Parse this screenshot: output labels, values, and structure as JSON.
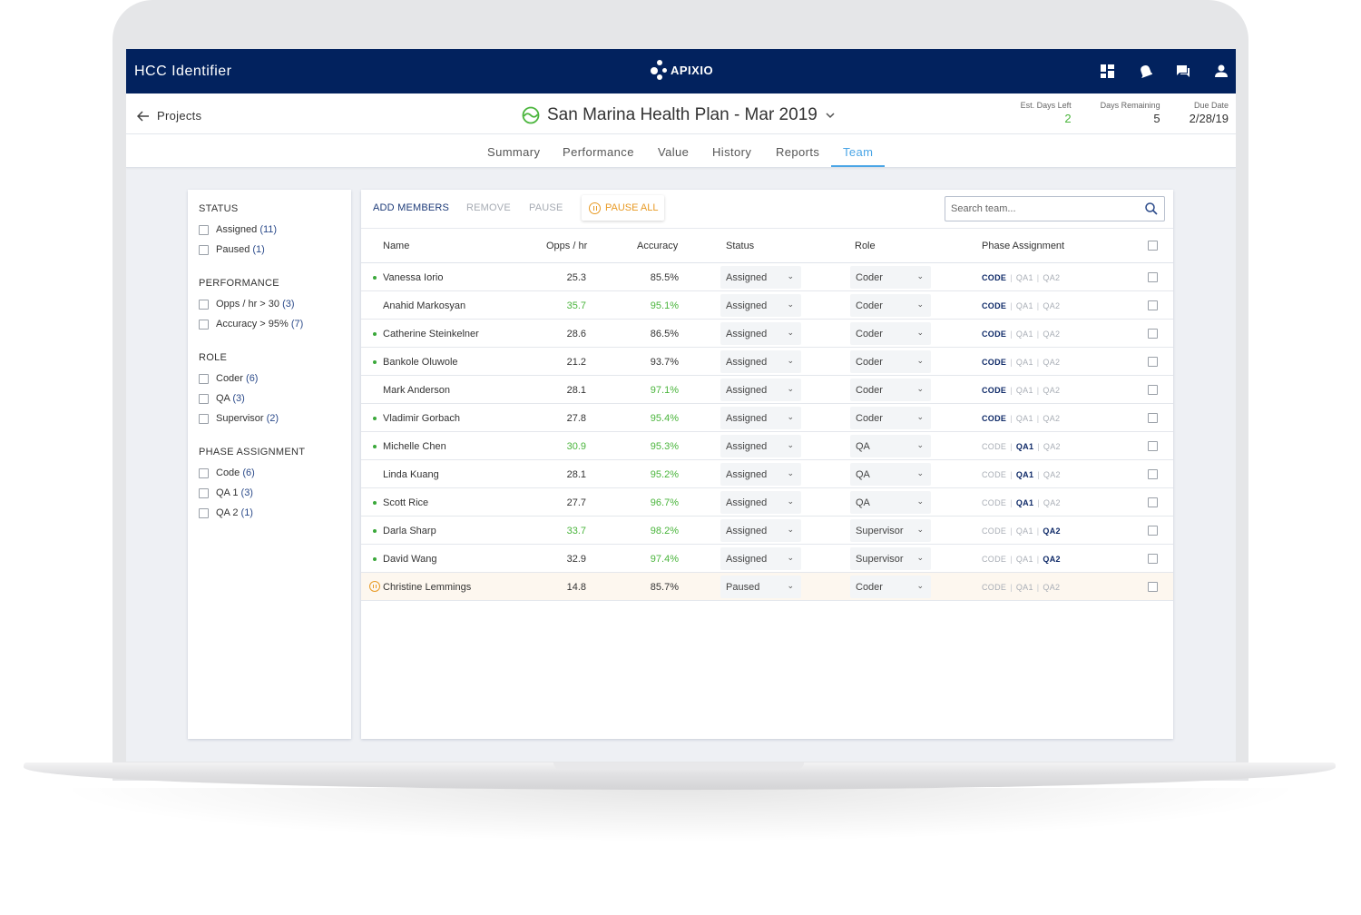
{
  "app": {
    "title": "HCC Identifier",
    "logo_text": "APIXIO"
  },
  "topbar_icons": [
    "dashboard-icon",
    "notifications-icon",
    "messages-icon",
    "user-icon"
  ],
  "header": {
    "back_label": "Projects",
    "project_title": "San Marina Health Plan - Mar 2019",
    "project_status_color": "#4ab53c",
    "stats": [
      {
        "label": "Est. Days Left",
        "value": "2",
        "color": "#4ab53c"
      },
      {
        "label": "Days Remaining",
        "value": "5"
      },
      {
        "label": "Due Date",
        "value": "2/28/19"
      }
    ]
  },
  "tabs": [
    {
      "label": "Summary"
    },
    {
      "label": "Performance"
    },
    {
      "label": "Value"
    },
    {
      "label": "History"
    },
    {
      "label": "Reports"
    },
    {
      "label": "Team",
      "active": true
    }
  ],
  "filters": {
    "groups": [
      {
        "title": "STATUS",
        "items": [
          {
            "label": "Assigned",
            "count": "(11)"
          },
          {
            "label": "Paused",
            "count": "(1)"
          }
        ]
      },
      {
        "title": "PERFORMANCE",
        "items": [
          {
            "label": "Opps / hr > 30",
            "count": "(3)"
          },
          {
            "label": "Accuracy > 95%",
            "count": "(7)"
          }
        ]
      },
      {
        "title": "ROLE",
        "items": [
          {
            "label": "Coder",
            "count": "(6)"
          },
          {
            "label": "QA",
            "count": "(3)"
          },
          {
            "label": "Supervisor",
            "count": "(2)"
          }
        ]
      },
      {
        "title": "PHASE ASSIGNMENT",
        "items": [
          {
            "label": "Code",
            "count": "(6)"
          },
          {
            "label": "QA 1",
            "count": "(3)"
          },
          {
            "label": "QA 2",
            "count": "(1)"
          }
        ]
      }
    ]
  },
  "toolbar": {
    "add_members": "ADD MEMBERS",
    "remove": "REMOVE",
    "pause": "PAUSE",
    "pause_all": "PAUSE ALL",
    "search_placeholder": "Search team..."
  },
  "table": {
    "columns": {
      "name": "Name",
      "opps": "Opps / hr",
      "accuracy": "Accuracy",
      "status": "Status",
      "role": "Role",
      "phase": "Phase Assignment"
    },
    "phase_labels": [
      "CODE",
      "QA1",
      "QA2"
    ],
    "rows": [
      {
        "indicator": "online",
        "name": "Vanessa Iorio",
        "opps": "25.3",
        "opps_high": false,
        "accuracy": "85.5%",
        "acc_high": false,
        "status": "Assigned",
        "role": "Coder",
        "phase": "CODE"
      },
      {
        "indicator": "none",
        "name": "Anahid Markosyan",
        "opps": "35.7",
        "opps_high": true,
        "accuracy": "95.1%",
        "acc_high": true,
        "status": "Assigned",
        "role": "Coder",
        "phase": "CODE"
      },
      {
        "indicator": "online",
        "name": "Catherine Steinkelner",
        "opps": "28.6",
        "opps_high": false,
        "accuracy": "86.5%",
        "acc_high": false,
        "status": "Assigned",
        "role": "Coder",
        "phase": "CODE"
      },
      {
        "indicator": "online",
        "name": "Bankole Oluwole",
        "opps": "21.2",
        "opps_high": false,
        "accuracy": "93.7%",
        "acc_high": false,
        "status": "Assigned",
        "role": "Coder",
        "phase": "CODE"
      },
      {
        "indicator": "none",
        "name": "Mark Anderson",
        "opps": "28.1",
        "opps_high": false,
        "accuracy": "97.1%",
        "acc_high": true,
        "status": "Assigned",
        "role": "Coder",
        "phase": "CODE"
      },
      {
        "indicator": "online",
        "name": "Vladimir Gorbach",
        "opps": "27.8",
        "opps_high": false,
        "accuracy": "95.4%",
        "acc_high": true,
        "status": "Assigned",
        "role": "Coder",
        "phase": "CODE"
      },
      {
        "indicator": "online",
        "name": "Michelle Chen",
        "opps": "30.9",
        "opps_high": true,
        "accuracy": "95.3%",
        "acc_high": true,
        "status": "Assigned",
        "role": "QA",
        "phase": "QA1"
      },
      {
        "indicator": "none",
        "name": "Linda Kuang",
        "opps": "28.1",
        "opps_high": false,
        "accuracy": "95.2%",
        "acc_high": true,
        "status": "Assigned",
        "role": "QA",
        "phase": "QA1"
      },
      {
        "indicator": "online",
        "name": "Scott Rice",
        "opps": "27.7",
        "opps_high": false,
        "accuracy": "96.7%",
        "acc_high": true,
        "status": "Assigned",
        "role": "QA",
        "phase": "QA1"
      },
      {
        "indicator": "online",
        "name": "Darla Sharp",
        "opps": "33.7",
        "opps_high": true,
        "accuracy": "98.2%",
        "acc_high": true,
        "status": "Assigned",
        "role": "Supervisor",
        "phase": "QA2"
      },
      {
        "indicator": "online",
        "name": "David Wang",
        "opps": "32.9",
        "opps_high": false,
        "accuracy": "97.4%",
        "acc_high": true,
        "status": "Assigned",
        "role": "Supervisor",
        "phase": "QA2"
      },
      {
        "indicator": "paused",
        "name": "Christine Lemmings",
        "opps": "14.8",
        "opps_high": false,
        "accuracy": "85.7%",
        "acc_high": false,
        "status": "Paused",
        "role": "Coder",
        "phase": "none"
      }
    ]
  },
  "colors": {
    "brand_navy": "#02225e",
    "accent_blue": "#4aa5e6",
    "good_green": "#4ab53c",
    "paused_orange": "#e89a24"
  }
}
